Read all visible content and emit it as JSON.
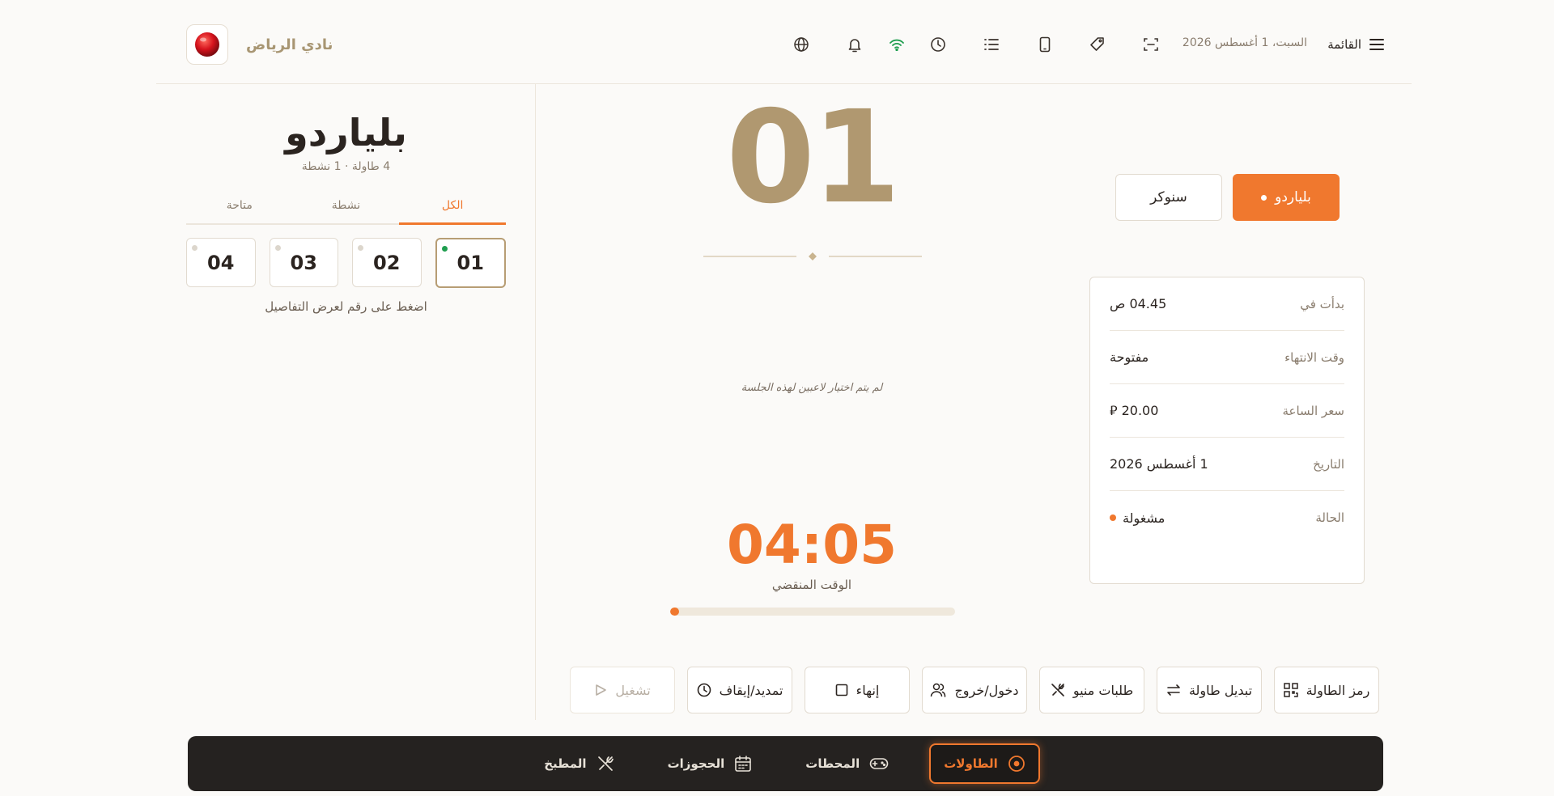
{
  "header": {
    "menu_label": "القائمة",
    "date": "السبت، 1 أغسطس 2026",
    "icons": [
      "scan-icon",
      "tag-icon",
      "phone-icon",
      "list-icon",
      "clock-icon",
      "wifi-icon",
      "bell-icon",
      "globe-icon"
    ],
    "club_name": "نادي الرياض"
  },
  "left_panel": {
    "title": "بلياردو",
    "subtitle": "4 طاولة · 1 نشطة",
    "tabs": [
      {
        "label": "الكل"
      },
      {
        "label": "نشطة"
      },
      {
        "label": "متاحة"
      }
    ],
    "tables": [
      {
        "number": "01"
      },
      {
        "number": "02"
      },
      {
        "number": "03"
      },
      {
        "number": "04"
      }
    ],
    "hint": "اضغط على رقم لعرض التفاصيل"
  },
  "center": {
    "table_number": "01",
    "no_players": "لم يتم اختيار لاعبين لهذه الجلسة",
    "timer": "04:05",
    "timer_label": "الوقت المنقضي",
    "progress_fraction": 0.03
  },
  "game_types": {
    "billiards": "بلياردو",
    "snooker": "سنوكر"
  },
  "info": {
    "started_label": "بدأت في",
    "started_value": "04.45 ص",
    "end_label": "وقت الانتهاء",
    "end_value": "مفتوحة",
    "price_label": "سعر الساعة",
    "price_value": "20.00 ⃁",
    "date_label": "التاريخ",
    "date_value": "1 أغسطس 2026",
    "status_label": "الحالة",
    "status_value": "مشغولة"
  },
  "actions": {
    "qr": "رمز الطاولة",
    "switch": "تبديل طاولة",
    "menu_orders": "طلبات منيو",
    "in_out": "دخول/خروج",
    "end": "إنهاء",
    "extend_pause": "تمديد/إيقاف",
    "start": "تشغيل"
  },
  "bottom_nav": {
    "tables": "الطاولات",
    "stations": "المحطات",
    "bookings": "الحجوزات",
    "kitchen": "المطبخ"
  },
  "colors": {
    "accent": "#f0782e",
    "gold": "#b09870",
    "active_dot": "#1f9e4f"
  }
}
